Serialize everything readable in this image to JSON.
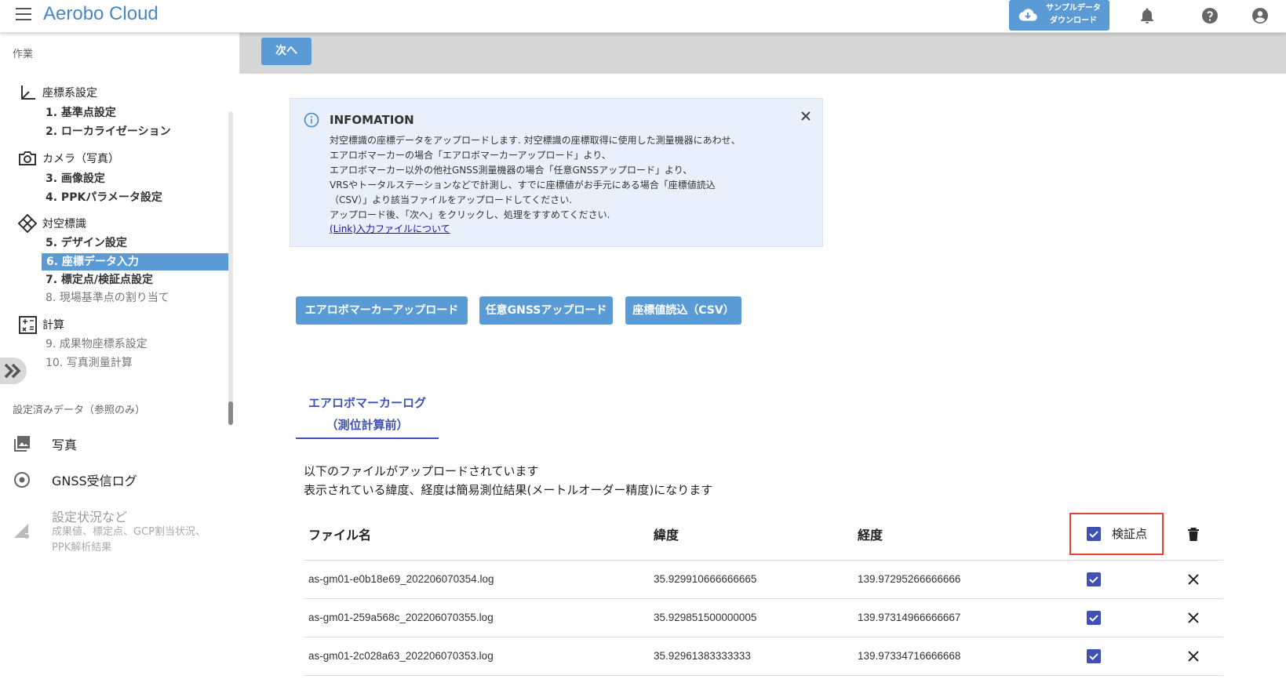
{
  "header": {
    "app_title": "Aerobo Cloud",
    "sample_download_line1": "サンプルデータ",
    "sample_download_line2": "ダウンロード"
  },
  "sidebar": {
    "section_label": "作業",
    "groups": [
      {
        "label": "座標系設定",
        "icon": "coordinate-axes-icon"
      },
      {
        "label": "カメラ（写真）",
        "icon": "camera-icon"
      },
      {
        "label": "対空標識",
        "icon": "diamond-marker-icon"
      },
      {
        "label": "計算",
        "icon": "calculator-icon"
      }
    ],
    "steps": [
      {
        "label": "1. 基準点設定",
        "state": "done"
      },
      {
        "label": "2. ローカライゼーション",
        "state": "done"
      },
      {
        "label": "3. 画像設定",
        "state": "done"
      },
      {
        "label": "4. PPKパラメータ設定",
        "state": "done"
      },
      {
        "label": "5. デザイン設定",
        "state": "done"
      },
      {
        "label": "6. 座標データ入力",
        "state": "active"
      },
      {
        "label": "7. 標定点/検証点設定",
        "state": "done"
      },
      {
        "label": "8. 現場基準点の割り当て",
        "state": "pending"
      },
      {
        "label": "9. 成果物座標系設定",
        "state": "pending"
      },
      {
        "label": "10. 写真測量計算",
        "state": "pending"
      }
    ],
    "ref_section_label": "設定済みデータ（参照のみ）",
    "ref_items": [
      {
        "label": "写真",
        "icon": "photo-library-icon"
      },
      {
        "label": "GNSS受信ログ",
        "icon": "radio-target-icon"
      },
      {
        "label": "設定状況など",
        "icon": "settings-signal-icon",
        "sub_line1": "成果値、標定点、GCP割当状況、",
        "sub_line2": "PPK解析結果"
      }
    ]
  },
  "toolbar": {
    "next_label": "次へ"
  },
  "info": {
    "title": "INFOMATION",
    "lines": [
      "対空標識の座標データをアップロードします. 対空標識の座標取得に使用した測量機器にあわせ、",
      "エアロボマーカーの場合「エアロボマーカーアップロード」より、",
      "エアロボマーカー以外の他社GNSS測量機器の場合「任意GNSSアップロード」より、",
      "VRSやトータルステーションなどで計測し、すでに座標値がお手元にある場合「座標値読込",
      "（CSV）」より該当ファイルをアップロードしてください.",
      "アップロード後、「次へ」をクリックし、処理をすすめてください."
    ],
    "link_text": "(Link)入力ファイルについて"
  },
  "upload_buttons": {
    "aerobo_marker": "エアロボマーカーアップロード",
    "any_gnss": "任意GNSSアップロード",
    "csv": "座標値読込（CSV）"
  },
  "tab": {
    "line1": "エアロボマーカーログ",
    "line2": "（測位計算前）"
  },
  "description": {
    "line1": "以下のファイルがアップロードされています",
    "line2": "表示されている緯度、経度は簡易測位結果(メートルオーダー精度)になります"
  },
  "table": {
    "headers": {
      "file": "ファイル名",
      "lat": "緯度",
      "lon": "経度",
      "check": "検証点"
    },
    "rows": [
      {
        "file": "as-gm01-e0b18e69_202206070354.log",
        "lat": "35.929910666666665",
        "lon": "139.97295266666666",
        "checked": true
      },
      {
        "file": "as-gm01-259a568c_202206070355.log",
        "lat": "35.929851500000005",
        "lon": "139.97314966666667",
        "checked": true
      },
      {
        "file": "as-gm01-2c028a63_202206070353.log",
        "lat": "35.92961383333333",
        "lon": "139.97334716666668",
        "checked": true
      }
    ]
  },
  "colors": {
    "accent": "#5b9bd5",
    "tab_indigo": "#3f51b5",
    "highlight_red": "#e0452e",
    "info_bg": "#e8f1fb"
  }
}
